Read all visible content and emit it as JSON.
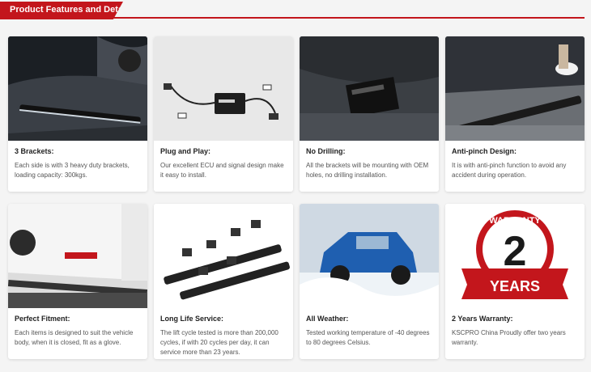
{
  "section": {
    "title": "Product Features and Details"
  },
  "cards": [
    {
      "title": "3 Brackets:",
      "desc": "Each side is with 3 heavy duty brackets, loading capacity: 300kgs."
    },
    {
      "title": "Plug and Play:",
      "desc": "Our excellent ECU and signal design make it easy to install."
    },
    {
      "title": "No Drilling:",
      "desc": "All the brackets will be mounting with OEM holes, no drilling installation."
    },
    {
      "title": "Anti-pinch Design:",
      "desc": "It is with anti-pinch function to avoid any accident during operation."
    },
    {
      "title": "Perfect Fitment:",
      "desc": "Each items is designed to suit the vehicle body, when it is closed, fit as a glove."
    },
    {
      "title": "Long Life Service:",
      "desc": "The lift cycle tested is more than 200,000 cycles, if with 20 cycles per day, it can service more than 23 years."
    },
    {
      "title": "All Weather:",
      "desc": "Tested working temperature of -40 degrees to 80 degrees Celsius."
    },
    {
      "title": "2 Years Warranty:",
      "desc": "KSCPRO China Proudly offer two years warranty."
    }
  ],
  "warranty_badge": {
    "top": "WARRANTY",
    "number": "2",
    "bottom": "YEARS"
  },
  "colors": {
    "accent": "#c3161c",
    "card_bg": "#ffffff",
    "page_bg": "#f4f4f4"
  }
}
